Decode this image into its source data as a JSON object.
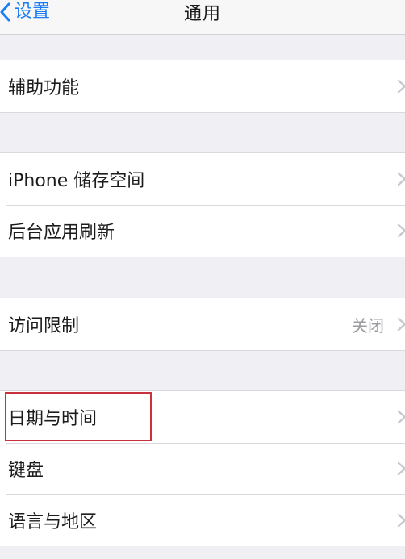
{
  "navbar": {
    "back_label": "设置",
    "title": "通用"
  },
  "groups": [
    {
      "rows": [
        {
          "label": "辅助功能"
        }
      ]
    },
    {
      "rows": [
        {
          "label": "iPhone 储存空间"
        },
        {
          "label": "后台应用刷新"
        }
      ]
    },
    {
      "rows": [
        {
          "label": "访问限制",
          "value": "关闭"
        }
      ]
    },
    {
      "rows": [
        {
          "label": "日期与时间"
        },
        {
          "label": "键盘"
        },
        {
          "label": "语言与地区"
        }
      ]
    }
  ],
  "icons": {
    "back": "chevron-left-icon",
    "disclosure": "chevron-right-icon"
  },
  "colors": {
    "accent": "#1a7cf6",
    "background": "#efeff4",
    "highlight": "#c8323c"
  }
}
